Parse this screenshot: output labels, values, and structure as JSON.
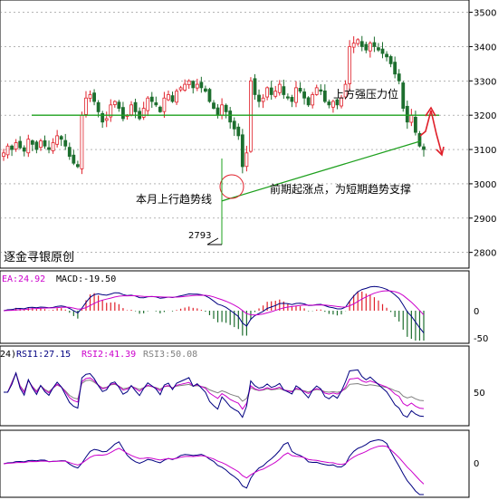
{
  "watermark": "逐金寻银原创",
  "annotations": {
    "resistance": "上方强压力位",
    "trendline": "本月上行趋势线",
    "support": "前期起涨点，为短期趋势支撑",
    "low_value": "2793"
  },
  "colors": {
    "up": "#e0202a",
    "down": "#1d6e2e",
    "line_green": "#1ea01e",
    "macd_diff": "#000080",
    "macd_dea": "#cc00cc",
    "rsi1": "#000080",
    "rsi2": "#cc00cc",
    "rsi3": "#808080",
    "arrow": "#e0202a"
  },
  "macd": {
    "labels": [
      "EA:24.92",
      "MACD:-19.50"
    ],
    "ticks": [
      "0",
      "-50"
    ]
  },
  "rsi": {
    "labels": [
      "24)",
      "RSI1:27.15",
      "RSI2:41.39",
      "RSI3:50.08"
    ],
    "ticks": [
      "50"
    ]
  },
  "bottom": {
    "ticks": [
      "0"
    ]
  },
  "chart_data": {
    "type": "candlestick",
    "y_ticks": [
      2800,
      2900,
      3000,
      3100,
      3200,
      3300,
      3400,
      3500
    ],
    "ylim": [
      2770,
      3520
    ],
    "grid": true,
    "resistance_level": 3200,
    "trendline": {
      "start_value": 2950,
      "end_value": 3125
    },
    "marked_low": 2793,
    "closes": [
      3090,
      3110,
      3100,
      3120,
      3105,
      3095,
      3130,
      3115,
      3100,
      3125,
      3110,
      3100,
      3120,
      3140,
      3130,
      3110,
      3080,
      3060,
      3050,
      3200,
      3250,
      3260,
      3240,
      3210,
      3180,
      3190,
      3230,
      3240,
      3220,
      3190,
      3200,
      3230,
      3210,
      3190,
      3220,
      3250,
      3240,
      3230,
      3210,
      3250,
      3260,
      3240,
      3270,
      3280,
      3290,
      3300,
      3280,
      3290,
      3280,
      3270,
      3240,
      3220,
      3200,
      3230,
      3210,
      3180,
      3160,
      3140,
      3050,
      3090,
      3300,
      3260,
      3240,
      3250,
      3280,
      3260,
      3270,
      3290,
      3260,
      3250,
      3240,
      3280,
      3270,
      3250,
      3230,
      3260,
      3280,
      3270,
      3240,
      3230,
      3240,
      3230,
      3250,
      3290,
      3400,
      3410,
      3420,
      3400,
      3390,
      3410,
      3400,
      3390,
      3380,
      3370,
      3350,
      3320,
      3300,
      3220,
      3180,
      3200,
      3150,
      3110,
      3100
    ]
  }
}
